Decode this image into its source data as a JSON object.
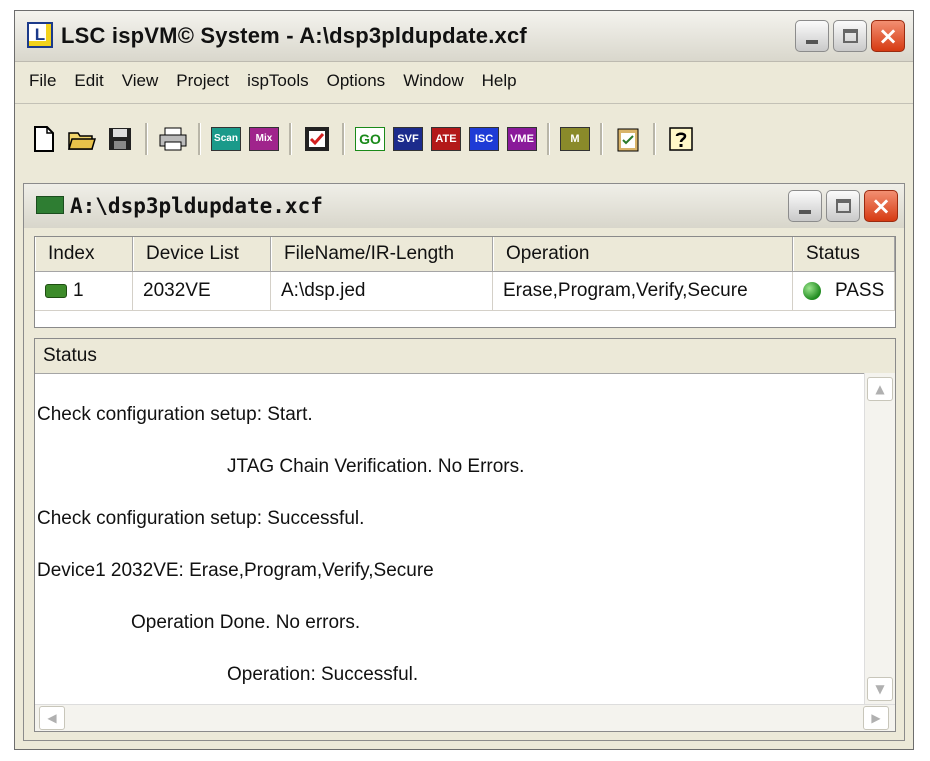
{
  "app": {
    "title": "LSC ispVM© System - A:\\dsp3pldupdate.xcf",
    "icon_letter": "L",
    "close_glyph": "×"
  },
  "menu": [
    "File",
    "Edit",
    "View",
    "Project",
    "ispTools",
    "Options",
    "Window",
    "Help"
  ],
  "toolbar": {
    "scan": "Scan",
    "mix_scan": "Mix",
    "go": "GO",
    "svf": "SVF",
    "ate": "ATE",
    "isc": "ISC",
    "vme": "VME",
    "m300": "M"
  },
  "child": {
    "title": "A:\\dsp3pldupdate.xcf",
    "close_glyph": "×"
  },
  "table": {
    "headers": [
      "Index",
      "Device List",
      "FileName/IR-Length",
      "Operation",
      "Status"
    ],
    "rows": [
      {
        "index": "1",
        "device": "2032VE",
        "file": "A:\\dsp.jed",
        "operation": "Erase,Program,Verify,Secure",
        "status": "PASS",
        "status_color": "#1e8a1e"
      }
    ]
  },
  "status_panel": {
    "header": "Status",
    "lines": [
      "Check configuration setup: Start.",
      "JTAG Chain Verification. No Errors.",
      "Check configuration setup: Successful.",
      "Device1 2032VE: Erase,Program,Verify,Secure",
      "Operation Done. No errors.",
      "Operation: Successful."
    ]
  },
  "scroll": {
    "up": "▲",
    "down": "▼",
    "left": "◀",
    "right": "▶"
  }
}
